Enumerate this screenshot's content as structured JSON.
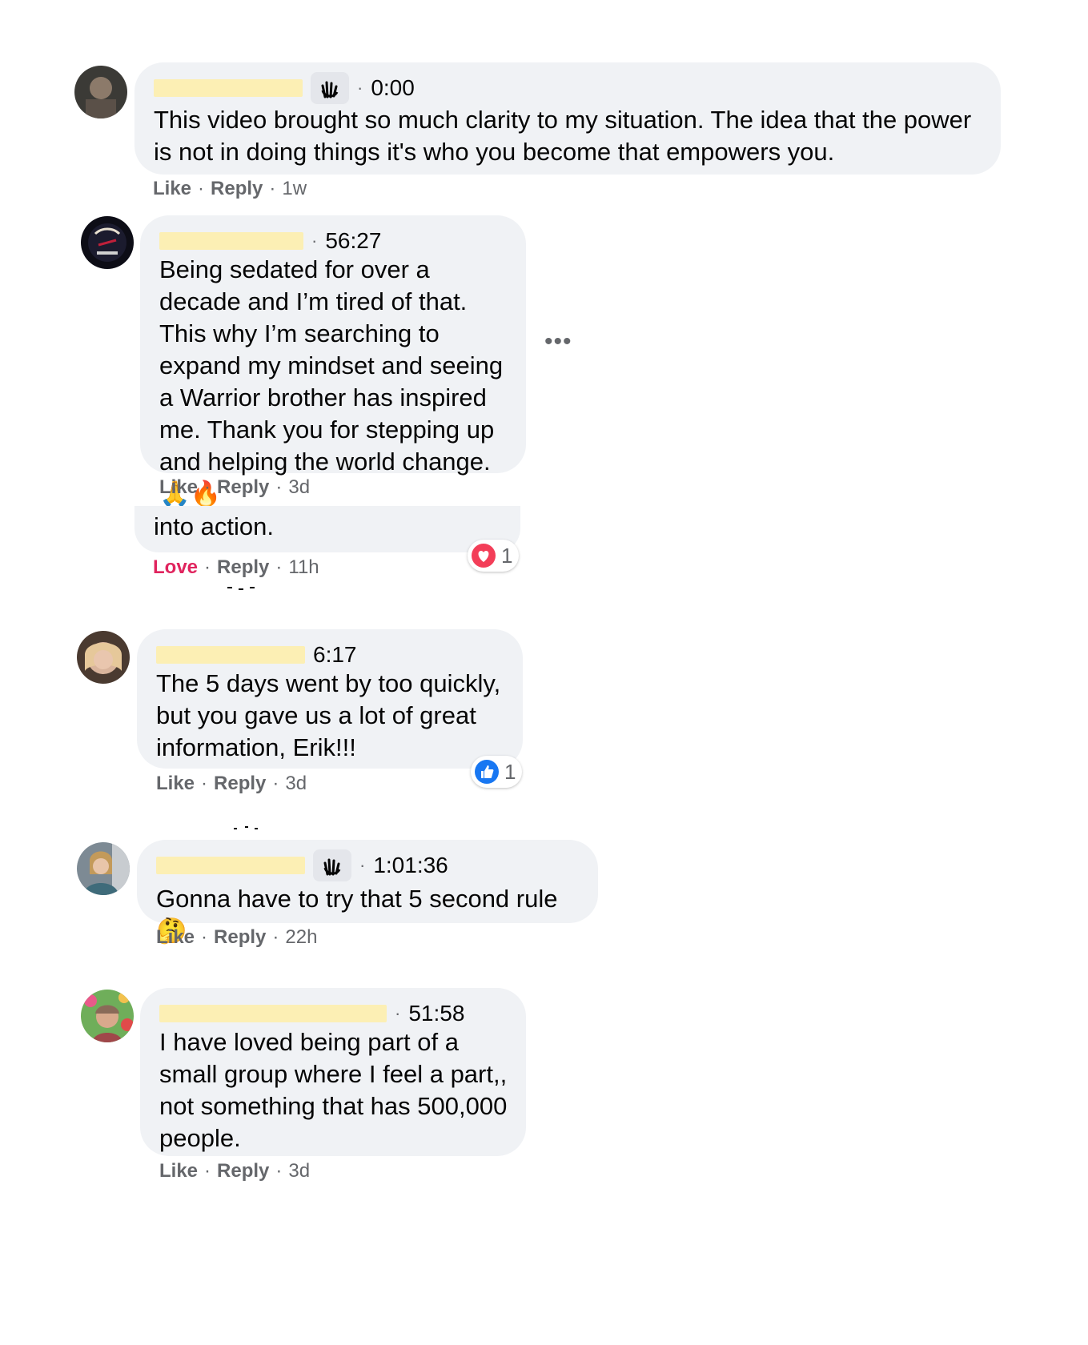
{
  "comments": [
    {
      "timestamp": "0:00",
      "text": "This video brought so much clarity to my situation. The idea that the power is not in doing things it's who you become that empowers you.",
      "action_like": "Like",
      "action_reply": "Reply",
      "age": "1w"
    },
    {
      "timestamp": "56:27",
      "text": "Being sedated for over a decade and I’m tired of that. This why I’m searching to expand my mindset and seeing a Warrior brother has inspired me. Thank you for stepping up and helping the world change. 🙏🔥",
      "action_like": "Like",
      "action_reply": "Reply",
      "age": "3d"
    },
    {
      "text": "into action.",
      "action_like": "Love",
      "action_reply": "Reply",
      "age": "11h",
      "reaction_count": "1"
    },
    {
      "timestamp": "6:17",
      "text": "The 5 days went by too quickly, but you gave us a lot of great information, Erik!!!",
      "action_like": "Like",
      "action_reply": "Reply",
      "age": "3d",
      "reaction_count": "1"
    },
    {
      "timestamp": "1:01:36",
      "text": "Gonna have to try that 5 second rule 🤔",
      "action_like": "Like",
      "action_reply": "Reply",
      "age": "22h"
    },
    {
      "timestamp": "51:58",
      "text": "I have loved being part of a small group where I feel a part,, not something that has 500,000 people.",
      "action_like": "Like",
      "action_reply": "Reply",
      "age": "3d"
    }
  ],
  "separator": "·",
  "colors": {
    "bubble": "#f0f2f5",
    "meta": "#65676b",
    "love": "#e0245e",
    "like_blue": "#1877f2",
    "redaction": "#fcefb4"
  }
}
